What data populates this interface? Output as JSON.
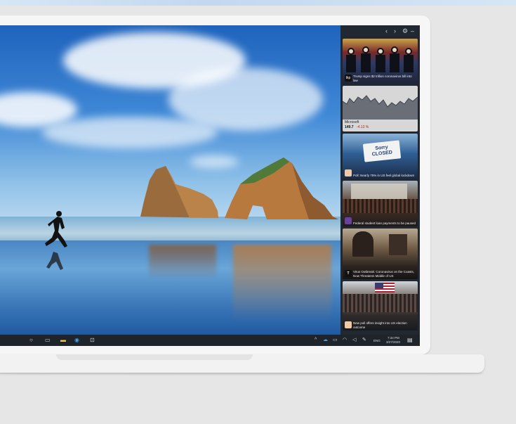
{
  "colors": {
    "page_bg": "#e6e6e6",
    "taskbar_bg": "#1f232a",
    "panel_bg": "#222831",
    "accent_blue": "#2f7ed8"
  },
  "widgets_panel": {
    "header_icons": [
      "chevron-left-icon",
      "chevron-right-icon",
      "gear-icon",
      "minimize-icon"
    ],
    "cards": [
      {
        "kind": "news",
        "source_badge": "tkp",
        "caption": "Trump signs $2 trillion coronavirus bill into law"
      },
      {
        "kind": "stock",
        "name": "Microsoft",
        "price": "149.7",
        "change": "-4.13 %"
      },
      {
        "kind": "news",
        "source_badge": "",
        "headline_in_image": "Sorry CLOSED",
        "caption": "Poll: Nearly 75% in US feel global lockdown"
      },
      {
        "kind": "news",
        "source_badge": "",
        "caption": "Federal student loan payments to be paused"
      },
      {
        "kind": "news",
        "source_badge": "T",
        "caption": "Virus Outbreak: Coronavirus on the Coasts, Now Threatens Middle of US"
      },
      {
        "kind": "news",
        "source_badge": "",
        "caption": "New poll offers insight into US election outcome"
      }
    ]
  },
  "taskbar": {
    "left_icons": [
      "search-icon",
      "task-view-icon",
      "file-explorer-icon",
      "edge-icon",
      "store-icon"
    ],
    "tray_icons": [
      "chevron-up-icon",
      "onedrive-icon",
      "battery-icon",
      "network-icon",
      "volume-icon",
      "pen-icon"
    ],
    "language": "ENG",
    "time": "7:34 PM",
    "date": "3/27/2020",
    "notification_icon": "notification-icon"
  }
}
